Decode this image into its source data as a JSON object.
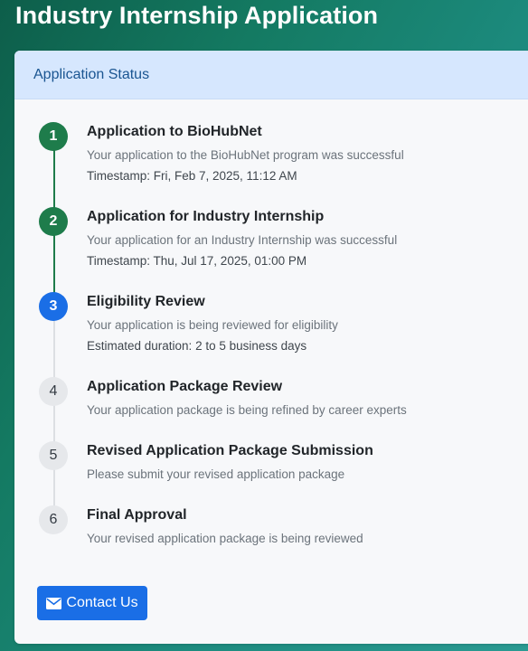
{
  "page": {
    "title": "Industry Internship Application"
  },
  "card": {
    "header": "Application Status"
  },
  "steps": [
    {
      "number": "1",
      "status": "completed",
      "title": "Application to BioHubNet",
      "description": "Your application to the BioHubNet program was successful",
      "meta": "Timestamp: Fri, Feb 7, 2025, 11:12 AM"
    },
    {
      "number": "2",
      "status": "completed",
      "title": "Application for Industry Internship",
      "description": "Your application for an Industry Internship was successful",
      "meta": "Timestamp: Thu, Jul 17, 2025, 01:00 PM"
    },
    {
      "number": "3",
      "status": "active",
      "title": "Eligibility Review",
      "description": "Your application is being reviewed for eligibility",
      "meta": "Estimated duration: 2 to 5 business days"
    },
    {
      "number": "4",
      "status": "pending",
      "title": "Application Package Review",
      "description": "Your application package is being refined by career experts"
    },
    {
      "number": "5",
      "status": "pending",
      "title": "Revised Application Package Submission",
      "description": "Please submit your revised application package"
    },
    {
      "number": "6",
      "status": "pending",
      "title": "Final Approval",
      "description": "Your revised application package is being reviewed"
    }
  ],
  "actions": {
    "contact_label": "Contact Us",
    "contact_icon": "envelope-icon"
  },
  "colors": {
    "completed": "#1e7c4b",
    "active": "#1a6ee6",
    "pending": "#e6e8eb",
    "header_bg": "#d6e7fe",
    "header_text": "#1a5591"
  }
}
